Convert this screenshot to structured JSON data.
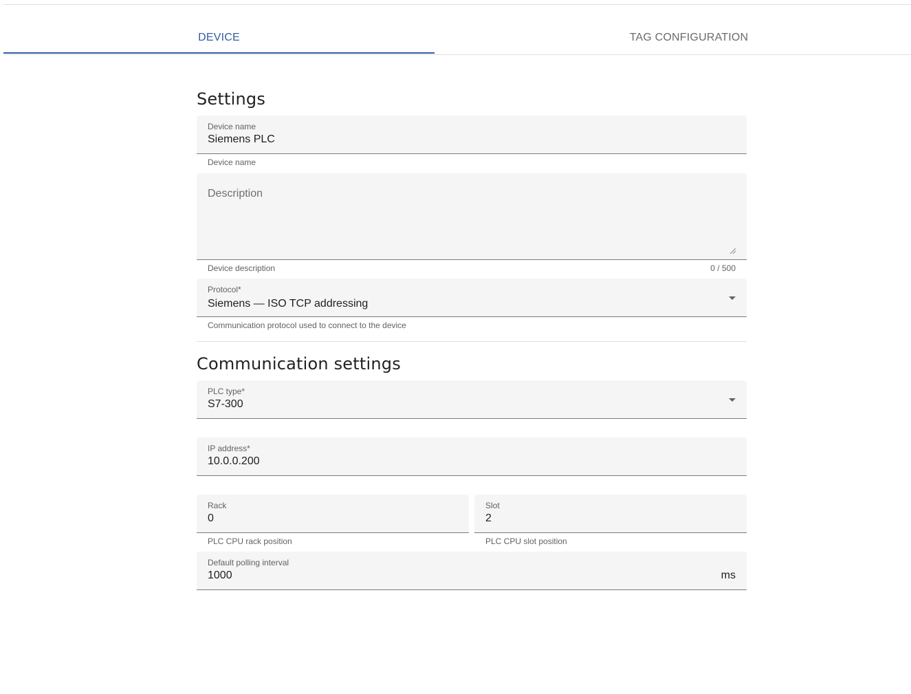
{
  "tabs": [
    {
      "label": "DEVICE",
      "active": true
    },
    {
      "label": "TAG CONFIGURATION",
      "active": false
    }
  ],
  "settings": {
    "title": "Settings",
    "device_name": {
      "label": "Device name",
      "value": "Siemens PLC",
      "hint": "Device name"
    },
    "description": {
      "placeholder": "Description",
      "hint": "Device description",
      "counter": "0 / 500"
    },
    "protocol": {
      "label": "Protocol*",
      "value": "Siemens — ISO TCP addressing",
      "hint": "Communication protocol used to connect to the device"
    }
  },
  "communication": {
    "title": "Communication settings",
    "plc_type": {
      "label": "PLC type*",
      "value": "S7-300"
    },
    "ip_address": {
      "label": "IP address*",
      "value": "10.0.0.200"
    },
    "rack": {
      "label": "Rack",
      "value": "0",
      "hint": "PLC CPU rack position"
    },
    "slot": {
      "label": "Slot",
      "value": "2",
      "hint": "PLC CPU slot position"
    },
    "polling": {
      "label": "Default polling interval",
      "value": "1000",
      "suffix": "ms"
    }
  },
  "colors": {
    "accent": "#2f5da3",
    "field_bg": "#f5f5f5"
  },
  "icons": {
    "dropdown": "caret-down-icon",
    "resize": "resize-handle-icon"
  }
}
